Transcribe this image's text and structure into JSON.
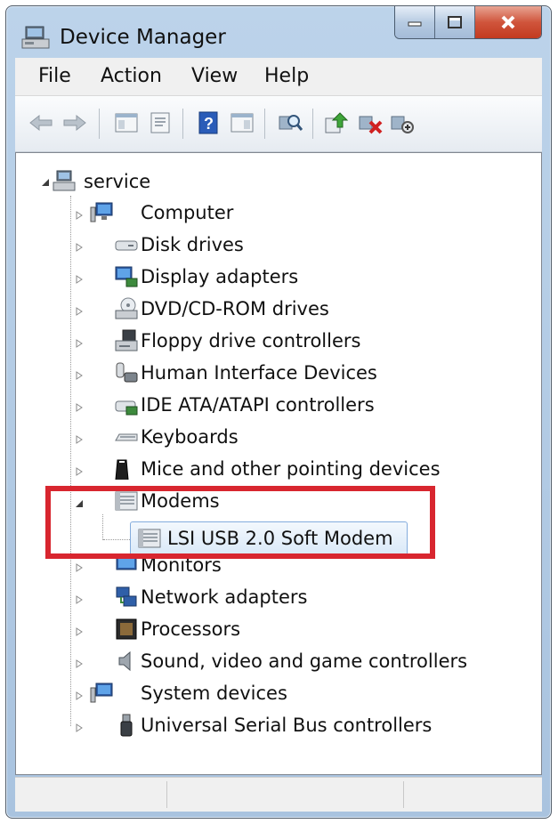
{
  "window": {
    "title": "Device Manager",
    "icon": "device-manager-icon",
    "buttons": {
      "minimize": "minimize-icon",
      "maximize": "maximize-icon",
      "close": "close-icon"
    }
  },
  "menu": {
    "items": [
      {
        "label": "File"
      },
      {
        "label": "Action"
      },
      {
        "label": "View"
      },
      {
        "label": "Help"
      }
    ]
  },
  "toolbar": {
    "icons": [
      "back-arrow-icon",
      "forward-arrow-icon",
      "show-hide-tree-icon",
      "properties-icon",
      "help-icon",
      "show-hide-action-pane-icon",
      "scan-hardware-icon",
      "update-driver-icon",
      "uninstall-icon",
      "disable-icon"
    ]
  },
  "tree": {
    "root": {
      "label": "service",
      "expanded": true,
      "icon": "computer-icon"
    },
    "items": [
      {
        "label": "Computer",
        "icon": "computer-icon",
        "expanded": false
      },
      {
        "label": "Disk drives",
        "icon": "disk-drive-icon",
        "expanded": false
      },
      {
        "label": "Display adapters",
        "icon": "display-adapter-icon",
        "expanded": false
      },
      {
        "label": "DVD/CD-ROM drives",
        "icon": "dvd-drive-icon",
        "expanded": false
      },
      {
        "label": "Floppy drive controllers",
        "icon": "floppy-controller-icon",
        "expanded": false
      },
      {
        "label": "Human Interface Devices",
        "icon": "hid-icon",
        "expanded": false
      },
      {
        "label": "IDE ATA/ATAPI controllers",
        "icon": "ide-controller-icon",
        "expanded": false
      },
      {
        "label": "Keyboards",
        "icon": "keyboard-icon",
        "expanded": false
      },
      {
        "label": "Mice and other pointing devices",
        "icon": "mouse-icon",
        "expanded": false
      },
      {
        "label": "Modems",
        "icon": "modem-icon",
        "expanded": true,
        "children": [
          {
            "label": "LSI USB 2.0 Soft Modem",
            "icon": "modem-icon",
            "selected": true
          }
        ]
      },
      {
        "label": "Monitors",
        "icon": "monitor-icon",
        "expanded": false
      },
      {
        "label": "Network adapters",
        "icon": "network-adapter-icon",
        "expanded": false
      },
      {
        "label": "Processors",
        "icon": "processor-icon",
        "expanded": false
      },
      {
        "label": "Sound, video and game controllers",
        "icon": "sound-icon",
        "expanded": false
      },
      {
        "label": "System devices",
        "icon": "system-devices-icon",
        "expanded": false
      },
      {
        "label": "Universal Serial Bus controllers",
        "icon": "usb-icon",
        "expanded": false
      }
    ]
  },
  "colors": {
    "highlight_border": "#d8262f",
    "selection": "#cce4f7"
  }
}
